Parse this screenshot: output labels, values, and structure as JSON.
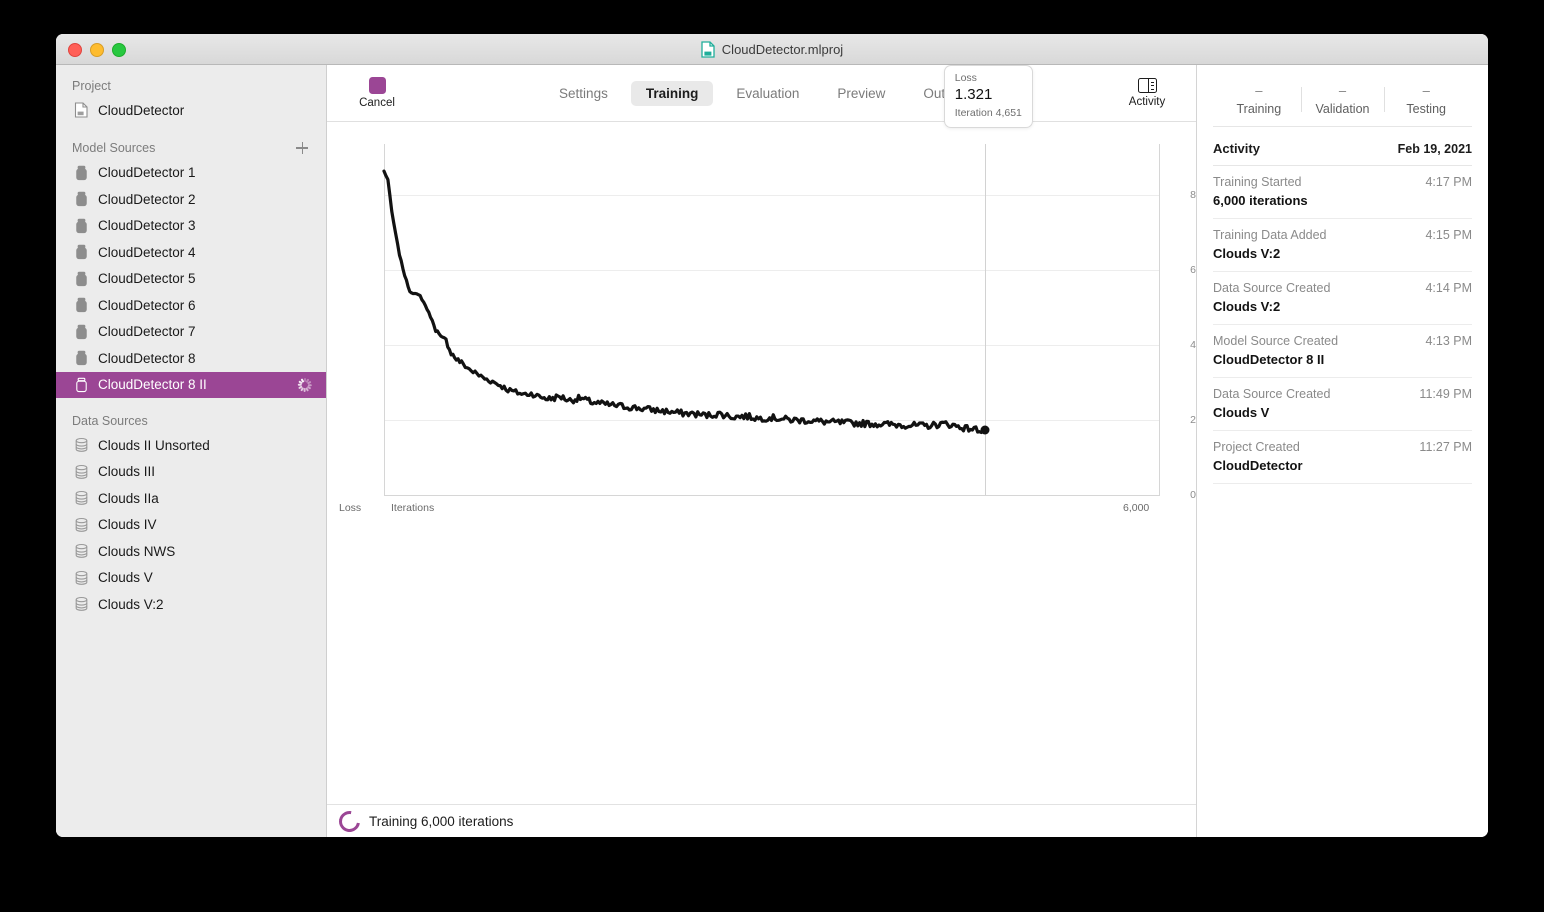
{
  "window": {
    "title": "CloudDetector.mlproj",
    "title_icon": "mlproj-document-icon",
    "traffic_lights": [
      "close",
      "minimize",
      "zoom"
    ]
  },
  "sidebar": {
    "project_section_title": "Project",
    "project_name": "CloudDetector",
    "model_sources_title": "Model Sources",
    "add_button_icon": "plus-icon",
    "model_sources": [
      {
        "label": "CloudDetector 1",
        "selected": false
      },
      {
        "label": "CloudDetector 2",
        "selected": false
      },
      {
        "label": "CloudDetector 3",
        "selected": false
      },
      {
        "label": "CloudDetector 4",
        "selected": false
      },
      {
        "label": "CloudDetector 5",
        "selected": false
      },
      {
        "label": "CloudDetector 6",
        "selected": false
      },
      {
        "label": "CloudDetector 7",
        "selected": false
      },
      {
        "label": "CloudDetector 8",
        "selected": false
      },
      {
        "label": "CloudDetector 8 II",
        "selected": true
      }
    ],
    "data_sources_title": "Data Sources",
    "data_sources": [
      {
        "label": "Clouds II Unsorted"
      },
      {
        "label": "Clouds III"
      },
      {
        "label": "Clouds IIa"
      },
      {
        "label": "Clouds IV"
      },
      {
        "label": "Clouds NWS"
      },
      {
        "label": "Clouds V"
      },
      {
        "label": "Clouds V:2"
      }
    ]
  },
  "toolbar": {
    "cancel_label": "Cancel",
    "cancel_icon": "stop-square-icon",
    "tabs": [
      {
        "label": "Settings",
        "active": false
      },
      {
        "label": "Training",
        "active": true
      },
      {
        "label": "Evaluation",
        "active": false
      },
      {
        "label": "Preview",
        "active": false
      },
      {
        "label": "Output",
        "active": false
      }
    ],
    "activity_label": "Activity",
    "activity_icon": "sidebar-panel-icon"
  },
  "status_bar": {
    "text": "Training 6,000 iterations",
    "spinner_icon": "progress-ring-icon",
    "accent_color": "#9b4695"
  },
  "chart_data": {
    "type": "line",
    "title": "",
    "xlabel": "Iterations",
    "ylabel": "Loss",
    "ylim": [
      0,
      9
    ],
    "xlim": [
      0,
      6000
    ],
    "yticks": [
      0,
      2,
      4,
      6,
      8
    ],
    "xticks": [
      6000
    ],
    "xtick_labels": [
      "6,000"
    ],
    "grid": true,
    "legend": "none",
    "line_color": "#121212",
    "series": [
      {
        "name": "Loss",
        "x": [
          0,
          30,
          60,
          90,
          120,
          160,
          200,
          240,
          280,
          320,
          360,
          400,
          440,
          480,
          520,
          560,
          600,
          660,
          720,
          780,
          840,
          900,
          960,
          1020,
          1080,
          1140,
          1200,
          1280,
          1360,
          1440,
          1520,
          1600,
          1700,
          1800,
          1900,
          2000,
          2100,
          2200,
          2300,
          2400,
          2500,
          2600,
          2700,
          2800,
          2900,
          3000,
          3150,
          3300,
          3450,
          3600,
          3750,
          3900,
          4050,
          4200,
          4350,
          4500,
          4651
        ],
        "y": [
          8.62,
          8.4,
          7.55,
          6.95,
          6.4,
          5.85,
          5.42,
          5.36,
          5.3,
          5.05,
          4.75,
          4.42,
          4.18,
          4.12,
          3.78,
          3.62,
          3.52,
          3.35,
          3.22,
          3.1,
          3.02,
          2.92,
          2.8,
          2.74,
          2.68,
          2.7,
          2.62,
          2.56,
          2.62,
          2.52,
          2.58,
          2.48,
          2.42,
          2.38,
          2.34,
          2.3,
          2.26,
          2.22,
          2.18,
          2.16,
          2.12,
          2.16,
          2.08,
          2.1,
          2.04,
          2.06,
          2.0,
          1.98,
          1.94,
          1.92,
          1.9,
          1.88,
          1.86,
          1.84,
          1.9,
          1.78,
          1.72
        ]
      }
    ],
    "tooltip": {
      "title": "Loss",
      "value": "1.321",
      "subtitle": "Iteration 4,651"
    }
  },
  "right_panel": {
    "stats": [
      {
        "value": "–",
        "label": "Training"
      },
      {
        "value": "–",
        "label": "Validation"
      },
      {
        "value": "–",
        "label": "Testing"
      }
    ],
    "activity_title": "Activity",
    "activity_date": "Feb 19, 2021",
    "activity_items": [
      {
        "kind": "Training Started",
        "time": "4:17 PM",
        "name": "6,000 iterations"
      },
      {
        "kind": "Training Data Added",
        "time": "4:15 PM",
        "name": "Clouds V:2"
      },
      {
        "kind": "Data Source Created",
        "time": "4:14 PM",
        "name": "Clouds V:2"
      },
      {
        "kind": "Model Source Created",
        "time": "4:13 PM",
        "name": "CloudDetector 8 II"
      },
      {
        "kind": "Data Source Created",
        "time": "11:49 PM",
        "name": "Clouds V"
      },
      {
        "kind": "Project Created",
        "time": "11:27 PM",
        "name": "CloudDetector"
      }
    ]
  }
}
